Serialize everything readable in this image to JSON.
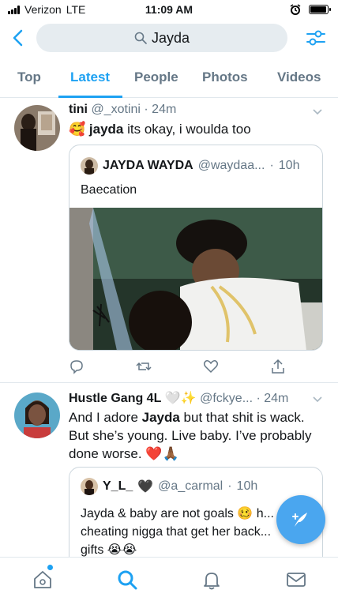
{
  "status_bar": {
    "carrier": "Verizon",
    "network": "LTE",
    "time": "11:09 AM",
    "battery_level": 0.95
  },
  "search": {
    "query": "Jayda"
  },
  "tabs": [
    {
      "label": "Top",
      "active": false
    },
    {
      "label": "Latest",
      "active": true
    },
    {
      "label": "People",
      "active": false
    },
    {
      "label": "Photos",
      "active": false
    },
    {
      "label": "Videos",
      "active": false
    }
  ],
  "tweets": [
    {
      "name": "tini",
      "handle": "@_xotini",
      "time": "24m",
      "text_emoji": "🥰",
      "text_bold": "jayda",
      "text_rest": " its okay, i woulda too",
      "quote": {
        "name": "JAYDA WAYDA",
        "handle": "@waydaa...",
        "time": "10h",
        "text": "Baecation"
      }
    },
    {
      "name": "Hustle Gang 4L",
      "name_emoji": "🤍✨",
      "handle": "@fckye...",
      "time": "24m",
      "text_before": "And I adore ",
      "text_bold": "Jayda",
      "text_after": " but that shit is wack. But she’s young. Live baby. I’ve probably done worse. ❤️🙏🏾",
      "quote": {
        "name": "Y_L_",
        "name_emoji": "🖤",
        "handle": "@a_carmal",
        "time": "10h",
        "text": "Jayda & baby are not goals 🥴 h... cheating nigga that get her back... gifts 😭😭"
      }
    }
  ],
  "colors": {
    "accent": "#1da1f2",
    "secondary_text": "#657786",
    "divider": "#e1e8ed",
    "like_icon": "#657786"
  }
}
